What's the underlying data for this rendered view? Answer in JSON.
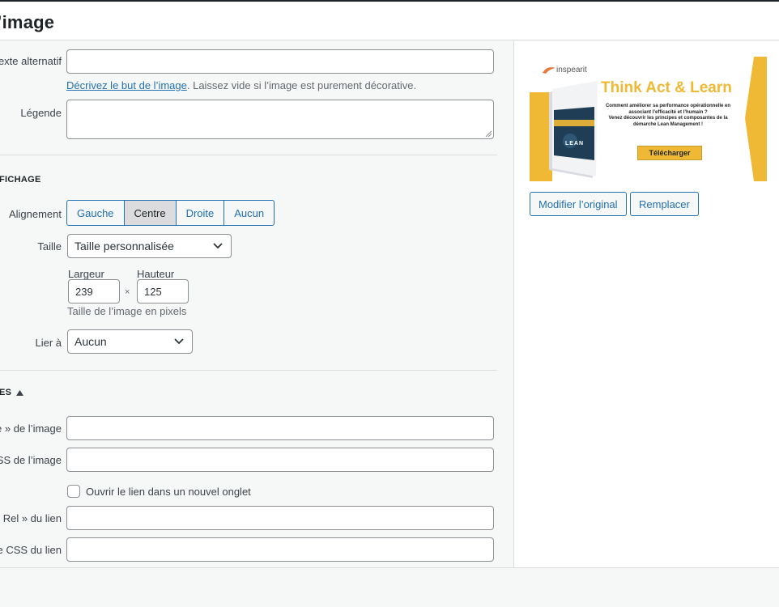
{
  "dialog": {
    "title": "l’image"
  },
  "text_settings": {
    "alt_label": "exte alternatif",
    "alt_value": "",
    "alt_help_link": "Décrivez le but de l’image",
    "alt_help_rest": ". Laissez vide si l’image est purement décorative.",
    "caption_label": "Légende",
    "caption_value": ""
  },
  "display_settings": {
    "heading": "FICHAGE",
    "alignment_label": "Alignement",
    "alignment_options": [
      "Gauche",
      "Centre",
      "Droite",
      "Aucun"
    ],
    "alignment_selected": "Centre",
    "size_label": "Taille",
    "size_value": "Taille personnalisée",
    "width_label": "Largeur",
    "height_label": "Hauteur",
    "width_value": "239",
    "height_value": "125",
    "times_symbol": "×",
    "dimensions_help": "Taille de l’image en pixels",
    "link_label": "Lier à",
    "link_value": "Aucun"
  },
  "advanced": {
    "heading": "ES",
    "toggle_icon": "triangle-up-icon",
    "title_attr_label": "e » de l’image",
    "title_attr_value": "",
    "css_class_label": "SS de l’image",
    "css_class_value": "",
    "new_tab_label": "Ouvrir le lien dans un nouvel onglet",
    "new_tab_checked": false,
    "rel_label": "« Rel » du lien",
    "rel_value": "",
    "link_css_label": "se CSS du lien",
    "link_css_value": ""
  },
  "preview": {
    "brand": "inspearit",
    "headline": "Think Act & Learn",
    "body_line1": "Comment améliorer sa performance opérationnelle en associant l’efficacité et l’humain ?",
    "body_line2": "Venez découvrir les principes et composantes de la démarche Lean Management !",
    "cta": "Télécharger",
    "book_label": "LEAN",
    "edit_button": "Modifier l’original",
    "replace_button": "Remplacer"
  },
  "colors": {
    "accent": "#2271b1",
    "promo_yellow": "#efb935",
    "promo_orange": "#e8773a"
  }
}
